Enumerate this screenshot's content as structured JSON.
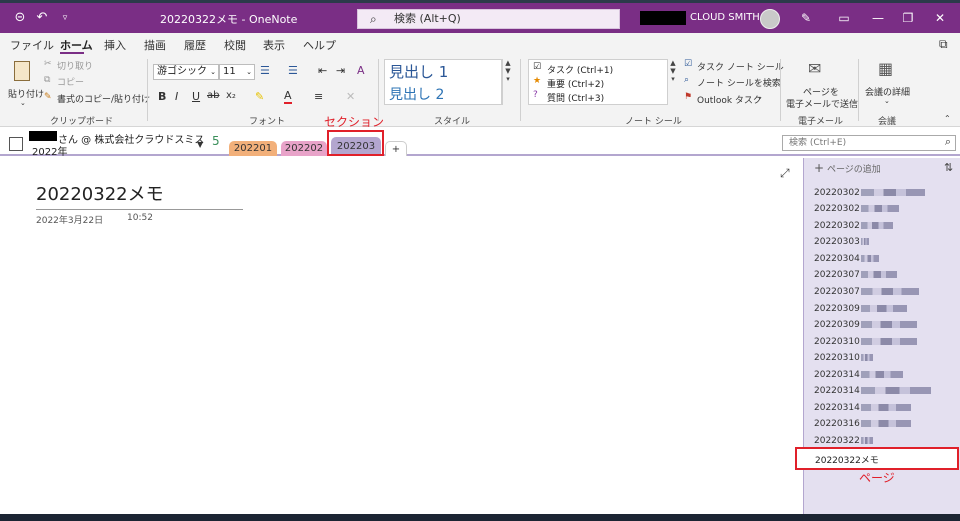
{
  "titlebar": {
    "doc_title": "20220322メモ  -  OneNote",
    "search_placeholder": "検索 (Alt+Q)",
    "user_name": "CLOUD SMITH"
  },
  "menu": {
    "items": [
      "ファイル",
      "ホーム",
      "挿入",
      "描画",
      "履歴",
      "校閲",
      "表示",
      "ヘルプ"
    ],
    "active": "ホーム"
  },
  "ribbon": {
    "clipboard": {
      "paste": "貼り付け",
      "cut": "切り取り",
      "copy": "コピー",
      "format_painter": "書式のコピー/貼り付け",
      "label": "クリップボード"
    },
    "font": {
      "family": "游ゴシック",
      "size": "11",
      "label": "フォント"
    },
    "styles": {
      "heading1": "見出し 1",
      "heading2": "見出し 2",
      "label": "スタイル"
    },
    "tags": {
      "items": [
        "タスク (Ctrl+1)",
        "重要 (Ctrl+2)",
        "質問 (Ctrl+3)"
      ],
      "todo_tag": "タスク ノート シール",
      "find_tags": "ノート シールを検索",
      "outlook_tasks": "Outlook タスク",
      "label": "ノート シール"
    },
    "email": {
      "line1": "ページを",
      "line2": "電子メールで送信",
      "label": "電子メール"
    },
    "meetings": {
      "line1": "会議の詳細",
      "label": "会議"
    }
  },
  "notebook": {
    "name": "さん @ 株式会社クラウドスミス",
    "year": "2022年",
    "tabs": [
      "202201",
      "202202",
      "202203"
    ],
    "active_tab": "202203",
    "search_placeholder": "検索 (Ctrl+E)"
  },
  "annotations": {
    "section_label": "セクション",
    "page_label": "ページ"
  },
  "page": {
    "title": "20220322メモ",
    "date": "2022年3月22日",
    "time": "10:52"
  },
  "pages": {
    "add_label": "ページの追加",
    "items": [
      "20220302",
      "20220302",
      "20220302",
      "20220303",
      "20220304",
      "20220307",
      "20220307",
      "20220309",
      "20220309",
      "20220310",
      "20220310",
      "20220314",
      "20220314",
      "20220314",
      "20220316",
      "20220322"
    ],
    "selected": "20220322メモ"
  },
  "colors": {
    "titlebar": "#7a2e85",
    "tab_202201": "#f2b07a",
    "tab_202202": "#e8a3c9",
    "tab_202203": "#b3a6cf",
    "annotation": "#e0202a"
  }
}
